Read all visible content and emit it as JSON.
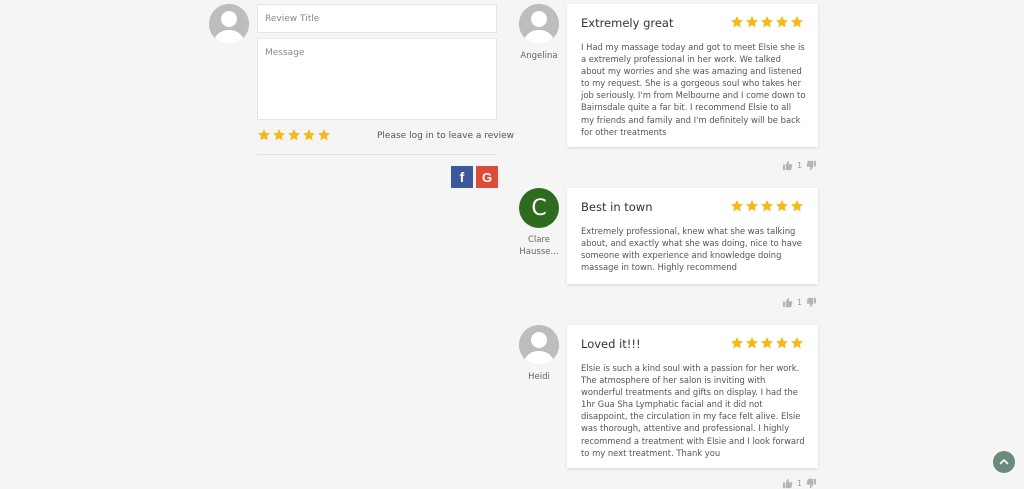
{
  "form": {
    "title_placeholder": "Review Title",
    "message_placeholder": "Message",
    "rating": 5,
    "login_note": "Please log in to leave a review",
    "social": {
      "facebook": "f",
      "google": "G"
    }
  },
  "reviews": [
    {
      "author": "Angelina",
      "title": "Extremely great",
      "rating": 5,
      "body": "I Had my massage today and got to meet Elsie she is a extremely professional in her work. We talked about my worries and she was amazing and listened to my request. She is a gorgeous soul who takes her job seriously. I'm from Melbourne and I come down to Bairnsdale quite a far bit. I recommend Elsie to all my friends and family and I'm definitely will be back for other treatments",
      "likes": "1"
    },
    {
      "author": "Clare Hausse...",
      "avatar_letter": "C",
      "title": "Best in town",
      "rating": 5,
      "body": "Extremely professional, knew what she was talking about, and exactly what she was doing, nice to have someone with experience and knowledge doing massage in town. Highly recommend",
      "likes": "1"
    },
    {
      "author": "Heidi",
      "title": "Loved it!!!",
      "rating": 5,
      "body": "Elsie is such a kind soul with a passion for her work. The atmosphere of her salon is inviting with wonderful treatments and gifts on display. I had the 1hr Gua Sha Lymphatic facial and it did not disappoint, the circulation in my face felt alive. Elsie was thorough, attentive and professional. I highly recommend a treatment with Elsie and I look forward to my next treatment. Thank you",
      "likes": "1"
    }
  ],
  "colors": {
    "star": "#f5b91a",
    "facebook": "#3b5998",
    "google": "#dd4b39",
    "avatar_letter_bg": "#2e6b1f",
    "fab": "#6b8b7a"
  },
  "icons": {
    "avatar": "user-silhouette-icon",
    "star": "star-icon",
    "like": "thumbs-up-icon",
    "dislike": "thumbs-down-icon",
    "fab": "chevron-up-icon"
  }
}
